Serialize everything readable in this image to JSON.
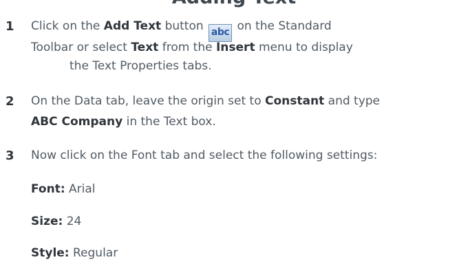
{
  "page_title": "Adding Text",
  "steps": [
    {
      "number": "1",
      "lines": [
        {
          "segments": [
            {
              "text": "Click on the ",
              "bold": false
            },
            {
              "text": "Add Text",
              "bold": true
            },
            {
              "text": " button",
              "bold": false
            }
          ],
          "icon": {
            "name": "add-text-icon",
            "label": "abc"
          },
          "after_icon": " on the Standard"
        },
        {
          "segments": [
            {
              "text": "Toolbar or select ",
              "bold": false
            },
            {
              "text": "Text",
              "bold": true
            },
            {
              "text": " from the ",
              "bold": false
            },
            {
              "text": "Insert",
              "bold": true
            },
            {
              "text": " menu to display",
              "bold": false
            }
          ]
        },
        {
          "segments": [
            {
              "text": "the Text Properties tabs.",
              "bold": false
            }
          ]
        }
      ]
    },
    {
      "number": "2",
      "lines": [
        {
          "segments": [
            {
              "text": "On the Data tab, leave the origin set to ",
              "bold": false
            },
            {
              "text": "Constant",
              "bold": true
            },
            {
              "text": " and type",
              "bold": false
            }
          ]
        },
        {
          "segments": [
            {
              "text": "ABC Company",
              "bold": true
            },
            {
              "text": " in the Text box.",
              "bold": false
            }
          ]
        }
      ]
    },
    {
      "number": "3",
      "lines": [
        {
          "segments": [
            {
              "text": "Now click on the Font tab and select the following settings:",
              "bold": false
            }
          ]
        }
      ]
    }
  ],
  "settings": [
    {
      "label": "Font:",
      "value": " Arial"
    },
    {
      "label": "Size:",
      "value": " 24"
    },
    {
      "label": "Style:",
      "value": " Regular"
    }
  ]
}
